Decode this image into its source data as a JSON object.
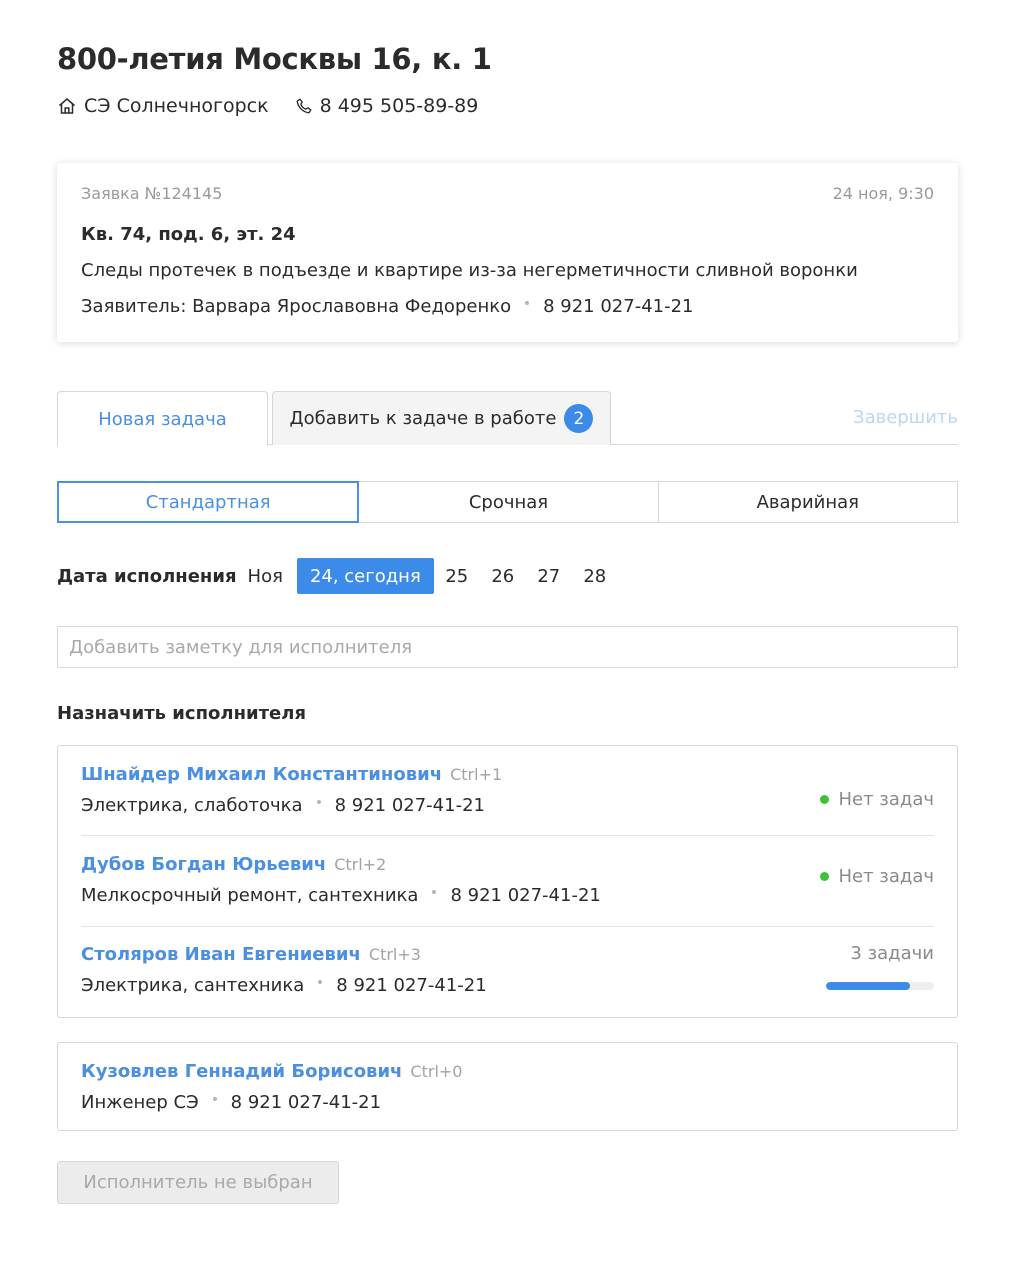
{
  "header": {
    "title": "800-летия Москвы 16, к. 1",
    "org_icon": "home-icon",
    "org": "СЭ Солнечногорск",
    "phone_icon": "phone-icon",
    "phone": "8 495 505-89-89"
  },
  "request": {
    "number": "Заявка №124145",
    "date": "24 ноя, 9:30",
    "address": "Кв. 74, под. 6, эт. 24",
    "description": "Следы протечек в подъезде и квартире из-за негерметичности сливной воронки",
    "applicant": "Заявитель: Варвара Ярославовна Федоренко",
    "applicant_phone": "8 921 027-41-21"
  },
  "tabs": {
    "new_task": "Новая задача",
    "add_to_task": "Добавить к задаче в работе",
    "add_to_task_count": "2",
    "finish": "Завершить"
  },
  "priority": {
    "options": [
      "Стандартная",
      "Срочная",
      "Аварийная"
    ],
    "selected": "Стандартная"
  },
  "due_date": {
    "label": "Дата исполнения",
    "month": "Ноя",
    "selected": "24, сегодня",
    "days": [
      "25",
      "26",
      "27",
      "28"
    ]
  },
  "note": {
    "placeholder": "Добавить заметку для исполнителя"
  },
  "assign_title": "Назначить исполнителя",
  "assignees": [
    {
      "name": "Шнайдер Михаил Константинович",
      "hotkey": "Ctrl+1",
      "specialty": "Электрика, слаботочка",
      "phone": "8 921 027-41-21",
      "status": "Нет задач"
    },
    {
      "name": "Дубов Богдан Юрьевич",
      "hotkey": "Ctrl+2",
      "specialty": "Мелкосрочный ремонт, сантехника",
      "phone": "8 921 027-41-21",
      "status": "Нет задач"
    },
    {
      "name": "Столяров Иван Евгениевич",
      "hotkey": "Ctrl+3",
      "specialty": "Электрика, сантехника",
      "phone": "8 921 027-41-21",
      "status": "3 задачи",
      "load_fraction": 0.78
    }
  ],
  "engineer": {
    "name": "Кузовлев Геннадий Борисович",
    "hotkey": "Ctrl+0",
    "role": "Инженер СЭ",
    "phone": "8 921 027-41-21"
  },
  "submit_label": "Исполнитель не выбран",
  "colors": {
    "accent": "#3d8be8",
    "link": "#4a8fe0",
    "status_ok": "#41c037",
    "disabled_text": "#a9a9a9"
  }
}
